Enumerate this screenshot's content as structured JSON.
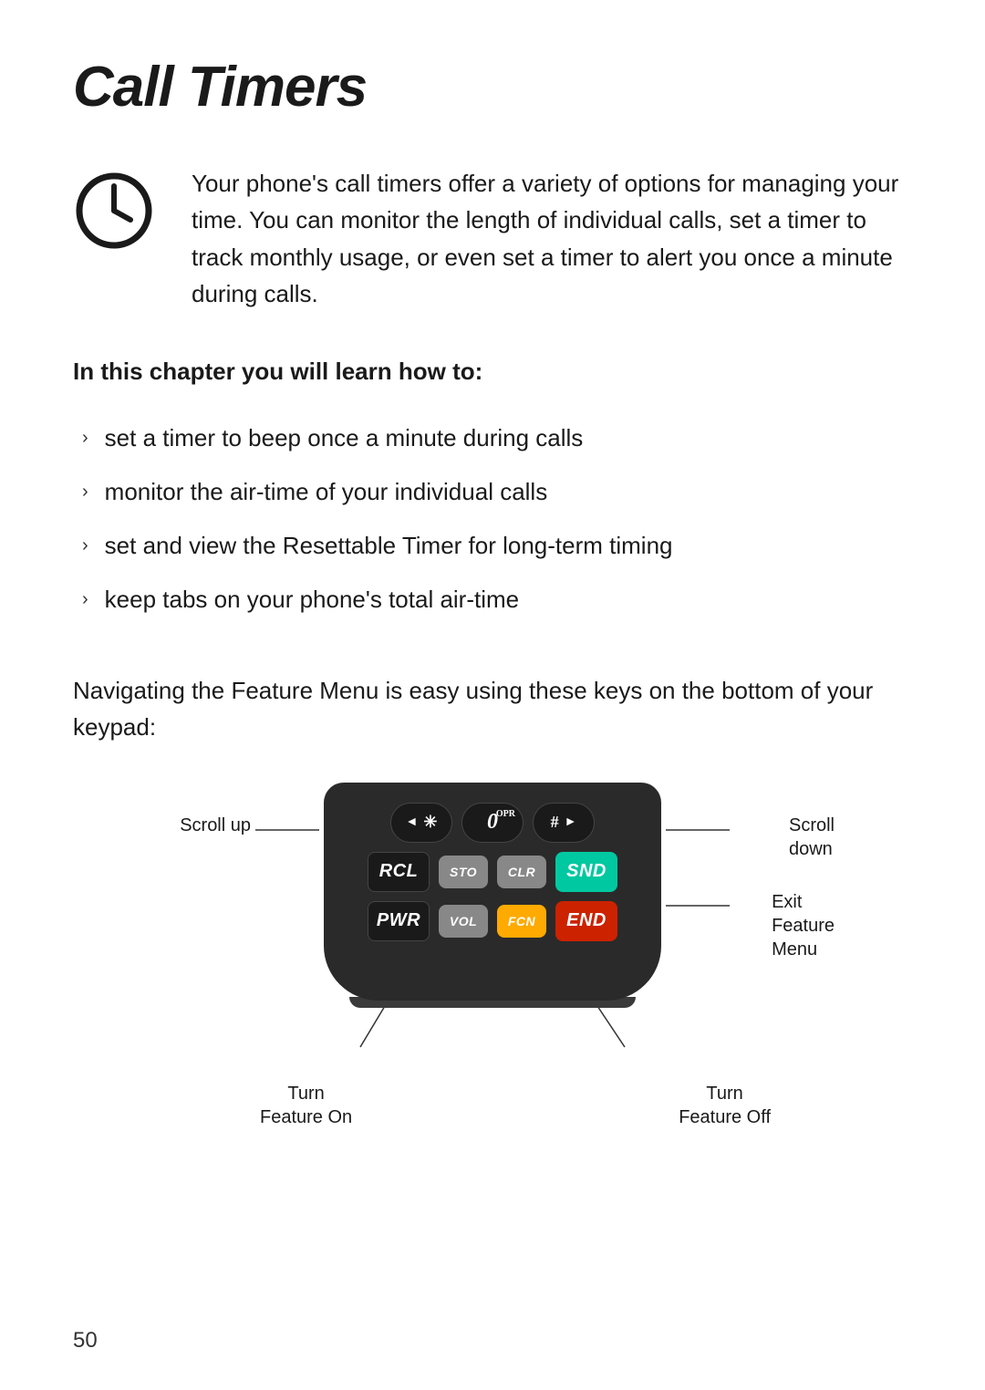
{
  "page": {
    "title": "Call Timers",
    "page_number": "50"
  },
  "intro": {
    "text": "Your phone's call timers offer a variety of options for managing your time. You can monitor the length of individual calls, set a timer to track monthly usage, or even set a timer to alert you once a minute during calls."
  },
  "chapter": {
    "heading": "In this chapter you will learn how to:"
  },
  "bullets": [
    {
      "text": "set a timer to beep once a minute during calls"
    },
    {
      "text": "monitor the air-time of your individual calls"
    },
    {
      "text": "set and view the Resettable Timer for long-term timing"
    },
    {
      "text": "keep tabs on your phone's total air-time"
    }
  ],
  "nav": {
    "text": "Navigating the Feature Menu is easy using these keys on the bottom of your keypad:"
  },
  "keypad": {
    "keys": {
      "star": "✳",
      "zero": "0",
      "opr": "OPR",
      "hash": "#",
      "rcl": "RCL",
      "sto": "STO",
      "clr": "CLR",
      "snd": "SND",
      "pwr": "PWR",
      "vol": "VOL",
      "fcn": "FCN",
      "end": "END"
    },
    "labels": {
      "scroll_up": "Scroll\nup",
      "scroll_down": "Scroll\ndown",
      "exit_feature_menu": "Exit\nFeature\nMenu",
      "turn_feature_on": "Turn\nFeature On",
      "turn_feature_off": "Turn\nFeature Off"
    }
  }
}
